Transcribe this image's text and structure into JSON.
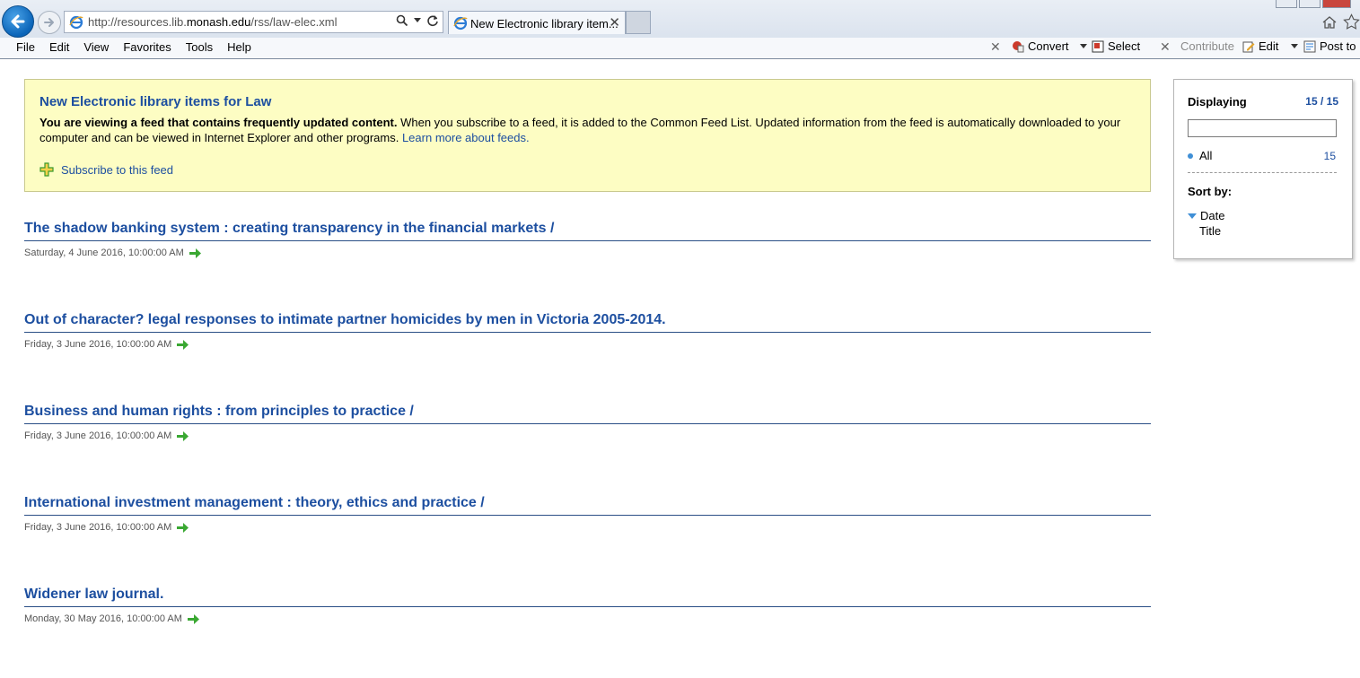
{
  "browser": {
    "url_prefix": "http://resources.lib.",
    "url_domain": "monash.edu",
    "url_suffix": "/rss/law-elec.xml",
    "tab_title": "New Electronic library item...",
    "tab_close": "✕"
  },
  "menu": {
    "items": [
      "File",
      "Edit",
      "View",
      "Favorites",
      "Tools",
      "Help"
    ]
  },
  "commands": {
    "convert": "Convert",
    "select": "Select",
    "contribute": "Contribute",
    "edit": "Edit",
    "post": "Post to B"
  },
  "banner": {
    "title": "New Electronic library items for Law",
    "notice_bold": "You are viewing a feed that contains frequently updated content.",
    "notice_text": " When you subscribe to a feed, it is added to the Common Feed List. Updated information from the feed is automatically downloaded to your computer and can be viewed in Internet Explorer and other programs. ",
    "learn_more": "Learn more about feeds.",
    "subscribe": "Subscribe to this feed"
  },
  "items": [
    {
      "title": "The shadow banking system : creating transparency in the financial markets /",
      "date": "Saturday, 4 June 2016, 10:00:00 AM"
    },
    {
      "title": "Out of character? legal responses to intimate partner homicides by men in Victoria 2005-2014.",
      "date": "Friday, 3 June 2016, 10:00:00 AM"
    },
    {
      "title": "Business and human rights : from principles to practice /",
      "date": "Friday, 3 June 2016, 10:00:00 AM"
    },
    {
      "title": "International investment management : theory, ethics and practice /",
      "date": "Friday, 3 June 2016, 10:00:00 AM"
    },
    {
      "title": "Widener law journal.",
      "date": "Monday, 30 May 2016, 10:00:00 AM"
    }
  ],
  "sidebar": {
    "displaying_label": "Displaying",
    "displaying_count": "15 / 15",
    "search_value": "",
    "all_label": "All",
    "all_count": "15",
    "sort_label": "Sort by:",
    "sort_date": "Date",
    "sort_title": "Title"
  },
  "colors": {
    "link_blue": "#1d4fa0",
    "banner_bg": "#fdfdc3",
    "arrow_green": "#3aa832"
  }
}
